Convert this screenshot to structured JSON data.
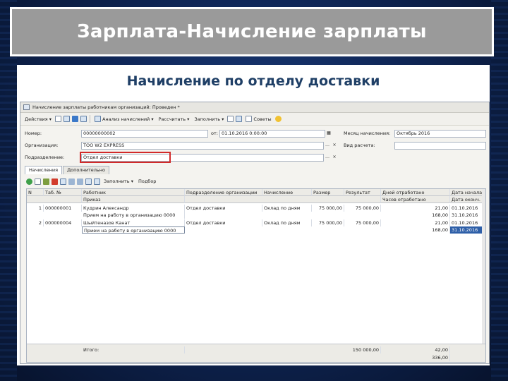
{
  "slide": {
    "title": "Зарплата-Начисление зарплаты",
    "subtitle": "Начисление по отделу доставки"
  },
  "window": {
    "title": "Начисление зарплаты работникам организаций: Проведен *"
  },
  "toolbar": {
    "actions_label": "Действия ▾",
    "analysis_label": "Анализ начислений ▾",
    "calculate_label": "Рассчитать ▾",
    "fill_label": "Заполнить ▾",
    "tips_label": "Советы"
  },
  "form": {
    "number_label": "Номер:",
    "number_value": "00000000002",
    "date_label": "от:",
    "date_value": "01.10.2016 0:00:00",
    "month_label": "Месяц начисления:",
    "month_value": "Октябрь 2016",
    "org_label": "Организация:",
    "org_value": "TOO W2 EXPRESS",
    "calc_type_label": "Вид расчета:",
    "calc_type_value": "",
    "dept_label": "Подразделение:",
    "dept_value": "Отдел доставки"
  },
  "tabs": [
    "Начисления",
    "Дополнительно"
  ],
  "table_toolbar": {
    "fill_label": "Заполнить ▾",
    "select_label": "Подбор"
  },
  "table": {
    "headers": {
      "num": "N",
      "tab_num": "Таб. №",
      "employee": "Работник",
      "department": "Подразделение организации",
      "accrual": "Начисление",
      "amount": "Размер",
      "result": "Результат",
      "days_paid": "Дней отработано",
      "start_date": "Дата начала",
      "order": "Приказ",
      "hours_paid": "Часов отработано",
      "end_date": "Дата оконч."
    },
    "rows": [
      {
        "num": "1",
        "tab_num": "000000001",
        "employee": "Кудрин Александр",
        "department": "Отдел доставки",
        "accrual": "Оклад по дням",
        "amount": "75 000,00",
        "result": "75 000,00",
        "days": "21,00",
        "start_date": "01.10.2016",
        "order": "Прием на работу в организацию 0000",
        "hours": "168,00",
        "end_date": "31.10.2016"
      },
      {
        "num": "2",
        "tab_num": "000000004",
        "employee": "Шыйтеназов Канат",
        "department": "Отдел доставки",
        "accrual": "Оклад по дням",
        "amount": "75 000,00",
        "result": "75 000,00",
        "days": "21,00",
        "start_date": "01.10.2016",
        "order": "Прием на работу в организацию 0000",
        "hours": "168,00",
        "end_date": "31.10.2016"
      }
    ],
    "totals": {
      "label": "Итого:",
      "result": "150 000,00",
      "days": "42,00",
      "hours": "336,00"
    }
  }
}
